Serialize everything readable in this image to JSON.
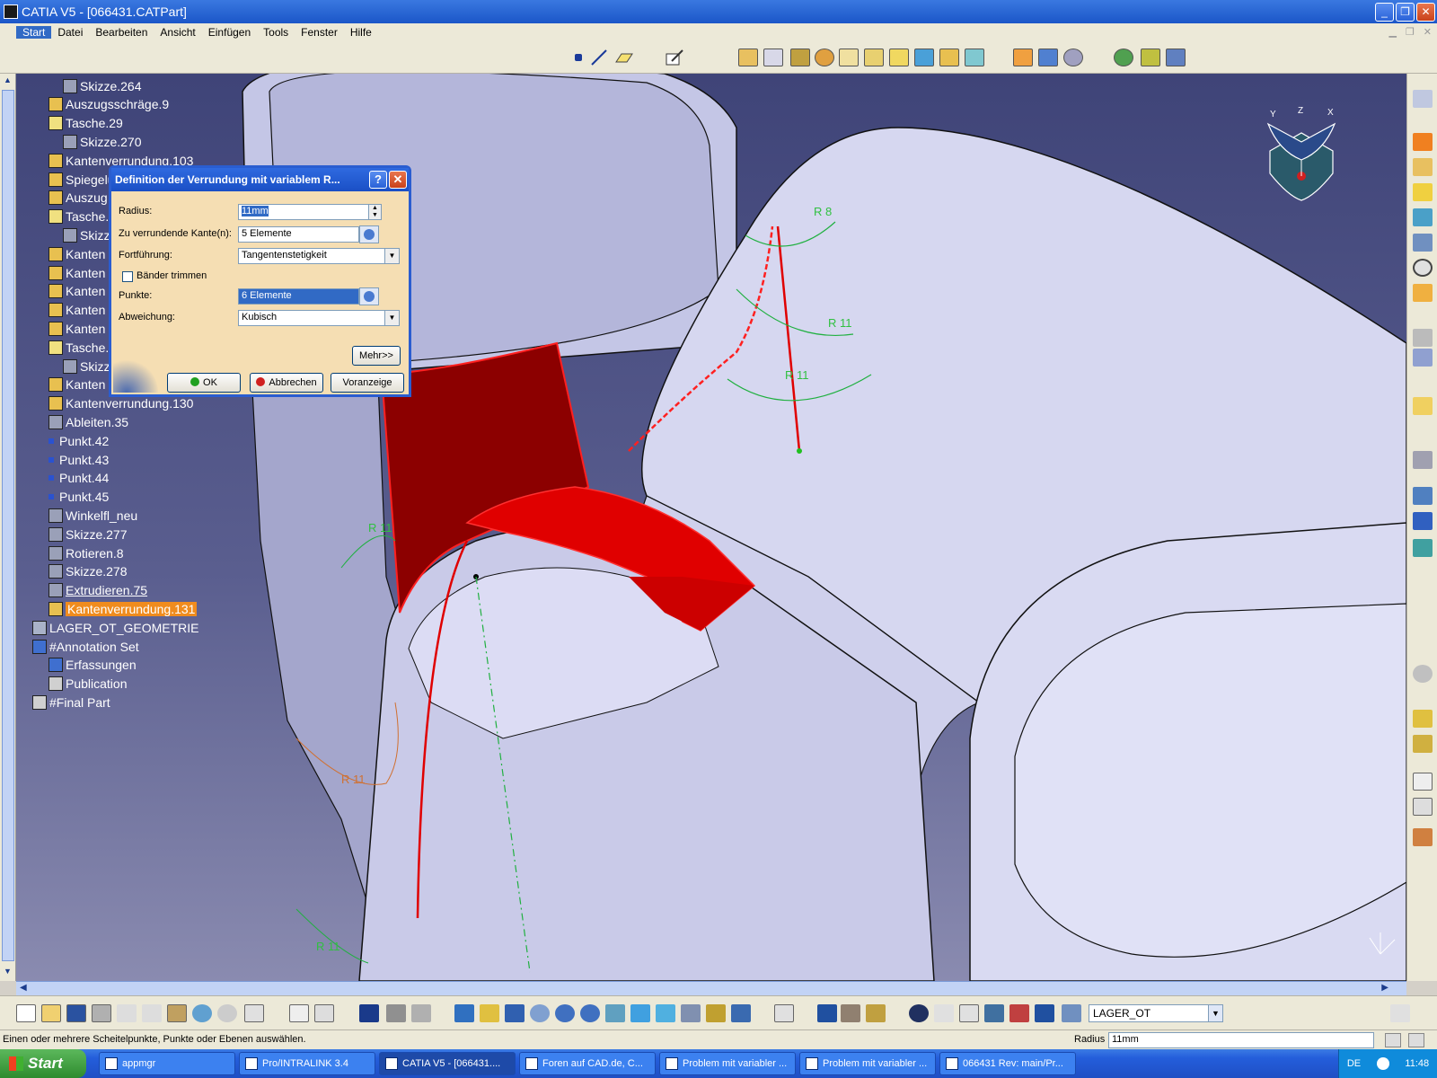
{
  "window": {
    "title": "CATIA V5 - [066431.CATPart]",
    "minimize": "_",
    "restore": "❐",
    "close": "✕"
  },
  "menu": [
    "Start",
    "Datei",
    "Bearbeiten",
    "Ansicht",
    "Einfügen",
    "Tools",
    "Fenster",
    "Hilfe"
  ],
  "tree": [
    {
      "label": "Skizze.264",
      "type": "sketch"
    },
    {
      "label": "Auszugsschräge.9",
      "type": "fillet"
    },
    {
      "label": "Tasche.29",
      "type": "pocket"
    },
    {
      "label": "Skizze.270",
      "type": "sketch"
    },
    {
      "label": "Kantenverrundung.103",
      "type": "fillet"
    },
    {
      "label": "Spiegelu",
      "type": "fillet"
    },
    {
      "label": "Auszug",
      "type": "fillet"
    },
    {
      "label": "Tasche.",
      "type": "pocket"
    },
    {
      "label": "Skizz",
      "type": "sketch"
    },
    {
      "label": "Kanten",
      "type": "fillet"
    },
    {
      "label": "Kanten",
      "type": "fillet"
    },
    {
      "label": "Kanten",
      "type": "fillet"
    },
    {
      "label": "Kanten",
      "type": "fillet"
    },
    {
      "label": "Kanten",
      "type": "fillet"
    },
    {
      "label": "Tasche.",
      "type": "pocket"
    },
    {
      "label": "Skizz",
      "type": "sketch"
    },
    {
      "label": "Kanten",
      "type": "fillet"
    },
    {
      "label": "Kantenverrundung.130",
      "type": "fillet"
    },
    {
      "label": "Ableiten.35",
      "type": "sketch"
    },
    {
      "label": "Punkt.42",
      "type": "point"
    },
    {
      "label": "Punkt.43",
      "type": "point"
    },
    {
      "label": "Punkt.44",
      "type": "point"
    },
    {
      "label": "Punkt.45",
      "type": "point"
    },
    {
      "label": "Winkelfl_neu",
      "type": "sketch"
    },
    {
      "label": "Skizze.277",
      "type": "sketch"
    },
    {
      "label": "Rotieren.8",
      "type": "sketch"
    },
    {
      "label": "Skizze.278",
      "type": "sketch"
    },
    {
      "label": "Extrudieren.75",
      "type": "sketch"
    },
    {
      "label": "Kantenverrundung.131",
      "type": "fillet"
    },
    {
      "label": "LAGER_OT_GEOMETRIE",
      "type": "body"
    },
    {
      "label": "#Annotation Set",
      "type": "ann"
    },
    {
      "label": "Erfassungen",
      "type": "ann"
    },
    {
      "label": "Publication",
      "type": "pub"
    },
    {
      "label": "#Final Part",
      "type": "pub"
    }
  ],
  "dialog": {
    "title": "Definition der Verrundung mit variablem R...",
    "help": "?",
    "close": "✕",
    "radius_label": "Radius:",
    "radius_value": "11mm",
    "edges_label": "Zu verrundende Kante(n):",
    "edges_value": "5 Elemente",
    "propagation_label": "Fortführung:",
    "propagation_value": "Tangentenstetigkeit",
    "trim_label": "Bänder trimmen",
    "points_label": "Punkte:",
    "points_value": "6 Elemente",
    "variation_label": "Abweichung:",
    "variation_value": "Kubisch",
    "more": "Mehr>>",
    "ok": "OK",
    "cancel": "Abbrechen",
    "preview": "Voranzeige"
  },
  "annotations": {
    "r8": "R 8",
    "r11a": "R 11",
    "r11b": "R 11",
    "r11c": "R 11",
    "r11d": "R 11",
    "r11e": "R 11"
  },
  "compass": {
    "x": "X",
    "y": "Y",
    "z": "Z"
  },
  "toolbar_bottom": {
    "body_select": "LAGER_OT"
  },
  "status": {
    "message": "Einen oder mehrere Scheitelpunkte, Punkte oder Ebenen auswählen.",
    "param_label": "Radius",
    "param_value": "11mm"
  },
  "taskbar": {
    "start": "Start",
    "tasks": [
      "appmgr",
      "Pro/INTRALINK 3.4",
      "CATIA V5 - [066431....",
      "Foren auf CAD.de, C...",
      "Problem mit variabler ...",
      "Problem mit variabler ...",
      "066431 Rev: main/Pr..."
    ],
    "lang": "DE",
    "clock": "11:48"
  }
}
